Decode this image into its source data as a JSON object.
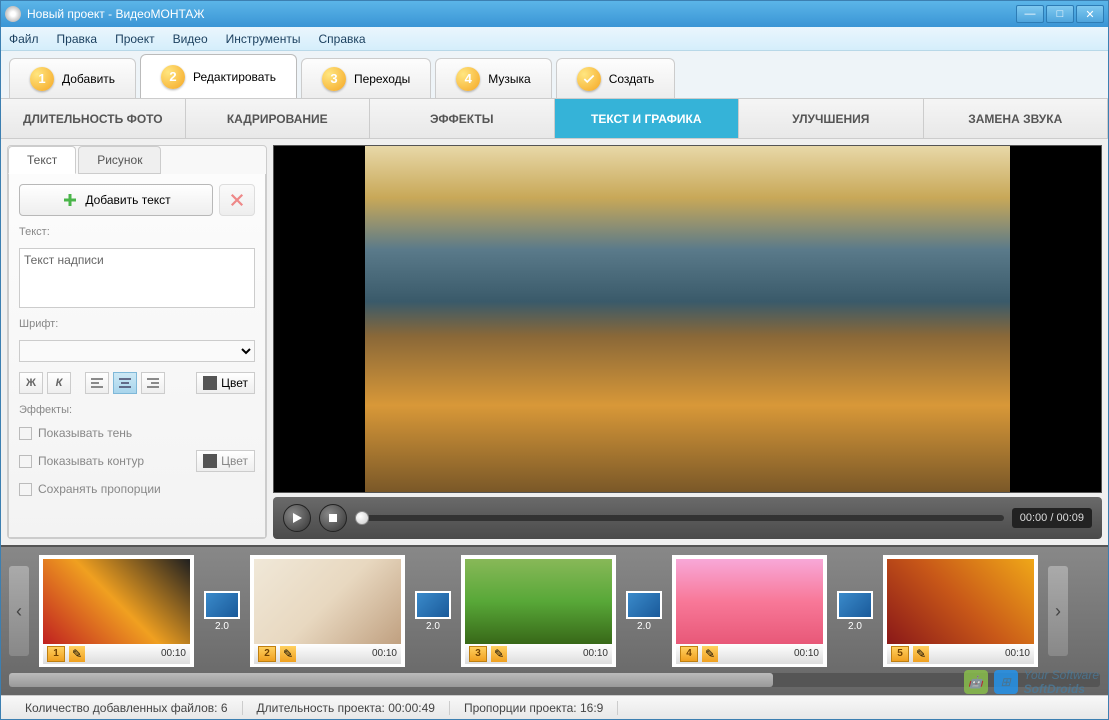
{
  "window": {
    "title": "Новый проект - ВидеоМОНТАЖ"
  },
  "menu": {
    "file": "Файл",
    "edit": "Правка",
    "project": "Проект",
    "video": "Видео",
    "tools": "Инструменты",
    "help": "Справка"
  },
  "steps": [
    {
      "num": "1",
      "label": "Добавить"
    },
    {
      "num": "2",
      "label": "Редактировать",
      "active": true
    },
    {
      "num": "3",
      "label": "Переходы"
    },
    {
      "num": "4",
      "label": "Музыка"
    },
    {
      "num": "✓",
      "label": "Создать",
      "check": true
    }
  ],
  "sub_tabs": {
    "duration": "ДЛИТЕЛЬНОСТЬ ФОТО",
    "crop": "КАДРИРОВАНИЕ",
    "effects": "ЭФФЕКТЫ",
    "text": "ТЕКСТ И ГРАФИКА",
    "enhance": "УЛУЧШЕНИЯ",
    "audio": "ЗАМЕНА ЗВУКА"
  },
  "panel": {
    "tab_text": "Текст",
    "tab_image": "Рисунок",
    "add_text": "Добавить текст",
    "text_label": "Текст:",
    "text_value": "Текст надписи",
    "font_label": "Шрифт:",
    "bold": "Ж",
    "italic": "К",
    "color": "Цвет",
    "effects_label": "Эффекты:",
    "shadow": "Показывать тень",
    "outline": "Показывать контур",
    "keep_ratio": "Сохранять пропорции"
  },
  "player": {
    "time": "00:00 / 00:09"
  },
  "clips": [
    {
      "num": "1",
      "time": "00:10"
    },
    {
      "num": "2",
      "time": "00:10"
    },
    {
      "num": "3",
      "time": "00:10"
    },
    {
      "num": "4",
      "time": "00:10"
    },
    {
      "num": "5",
      "time": "00:10"
    }
  ],
  "transition_time": "2.0",
  "status": {
    "files": "Количество добавленных файлов:  6",
    "duration": "Длительность проекта:   00:00:49",
    "ratio": "Пропорции проекта:   16:9"
  },
  "watermark": {
    "line1": "Your Software",
    "line2": "SoftDroids"
  }
}
